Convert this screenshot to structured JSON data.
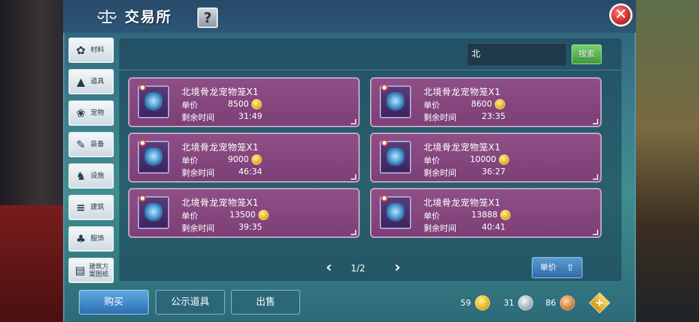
{
  "header": {
    "title": "交易所",
    "help_label": "?",
    "close_label": "✕"
  },
  "sidebar": {
    "items": [
      {
        "label": "材料",
        "icon": "flower-icon",
        "glyph": "✿"
      },
      {
        "label": "道具",
        "icon": "cone-icon",
        "glyph": "▲"
      },
      {
        "label": "宠物",
        "icon": "paw-icon",
        "glyph": "❀"
      },
      {
        "label": "装备",
        "icon": "armor-icon",
        "glyph": "✎"
      },
      {
        "label": "设施",
        "icon": "horse-icon",
        "glyph": "♞"
      },
      {
        "label": "建筑",
        "icon": "bricks-icon",
        "glyph": "≡"
      },
      {
        "label": "服饰",
        "icon": "shirt-icon",
        "glyph": "♣"
      },
      {
        "label": "建筑方案图纸",
        "icon": "blueprint-icon",
        "glyph": "▤"
      }
    ]
  },
  "search": {
    "value": "北",
    "button_label": "搜索"
  },
  "listing_labels": {
    "price": "单价",
    "time_left": "剩余时间"
  },
  "listings": [
    {
      "name": "北境骨龙宠物笼X1",
      "price": "8500",
      "time": "31:49"
    },
    {
      "name": "北境骨龙宠物笼X1",
      "price": "8600",
      "time": "23:35"
    },
    {
      "name": "北境骨龙宠物笼X1",
      "price": "9000",
      "time": "46:34"
    },
    {
      "name": "北境骨龙宠物笼X1",
      "price": "10000",
      "time": "36:27"
    },
    {
      "name": "北境骨龙宠物笼X1",
      "price": "13500",
      "time": "39:35"
    },
    {
      "name": "北境骨龙宠物笼X1",
      "price": "13888",
      "time": "40:41"
    }
  ],
  "pagination": {
    "page": "1/2",
    "prev": "‹",
    "next": "›"
  },
  "sort": {
    "label": "单价",
    "icon": "sort-arrow-icon"
  },
  "bottom_tabs": {
    "buy": "购买",
    "show": "公示道具",
    "sell": "出售"
  },
  "currency": {
    "gold": "59",
    "silver": "31",
    "bronze": "86"
  },
  "colors": {
    "card_bg": "#8e4f86",
    "panel_bg": "#3b7e8c",
    "buy_button": "#3b82c4",
    "search_button": "#4caf45"
  }
}
